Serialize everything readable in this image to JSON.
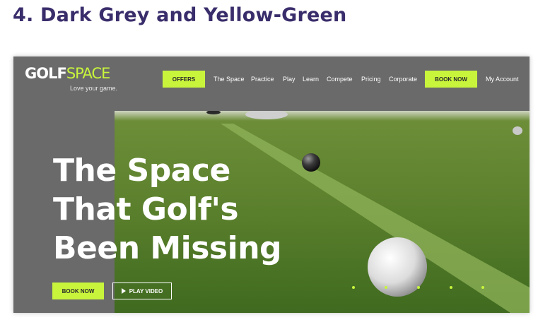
{
  "heading": "4. Dark Grey and Yellow-Green",
  "colors": {
    "heading": "#3a2d6b",
    "accent": "#c8f53c",
    "panel": "#6a6a6a"
  },
  "site": {
    "logo": {
      "golf": "GOLF",
      "space": "SPACE",
      "tagline": "Love your game."
    },
    "nav": {
      "offers": "OFFERS",
      "links": [
        "The Space",
        "Practice",
        "Play",
        "Learn",
        "Compete",
        "Pricing",
        "Corporate"
      ],
      "book_now": "BOOK NOW",
      "account": "My Account"
    },
    "hero": {
      "title_lines": [
        "The Space",
        "That Golf's",
        "Been Missing"
      ],
      "book_now": "BOOK NOW",
      "play_video": "PLAY VIDEO"
    },
    "carousel": {
      "slide_count": 5,
      "icon": "play-icon"
    }
  }
}
